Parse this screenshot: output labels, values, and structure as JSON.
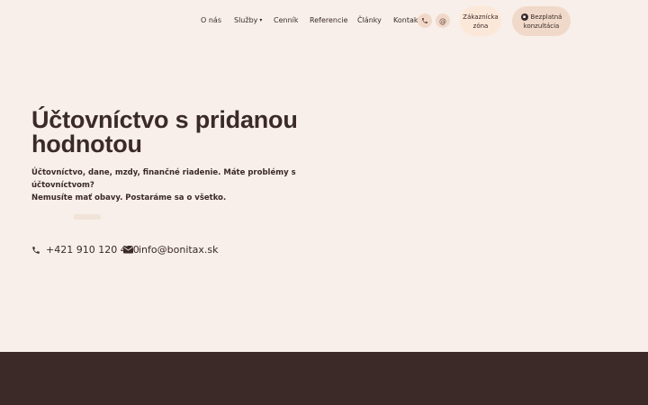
{
  "nav": {
    "items": [
      {
        "label": "O nás"
      },
      {
        "label": "Služby",
        "has_dropdown": true
      },
      {
        "label": "Cenník"
      },
      {
        "label": "Referencie"
      },
      {
        "label": "Články"
      },
      {
        "label": "Kontakt"
      }
    ],
    "phone_icon": "phone-icon",
    "email_icon": "at-icon",
    "customer_zone_line1": "Zákaznícka",
    "customer_zone_line2": "zóna",
    "consult_line1": "Bezplatná",
    "consult_line2": "konzultácia",
    "consult_icon": "calendar-icon"
  },
  "hero": {
    "title": "Účtovníctvo s pridanou hodnotou",
    "subtitle_line1": "Účtovníctvo, dane, mzdy, finančné riadenie. Máte problémy s účtovníctvom?",
    "subtitle_line2": "Nemusíte mať obavy. Postaráme sa o všetko."
  },
  "contact": {
    "phone": "+421 910 120 450",
    "email": "info@bonitax.sk"
  },
  "colors": {
    "background": "#f8efea",
    "text": "#3a2a28",
    "accent": "#f0d9c9",
    "footer": "#3c2a29"
  }
}
